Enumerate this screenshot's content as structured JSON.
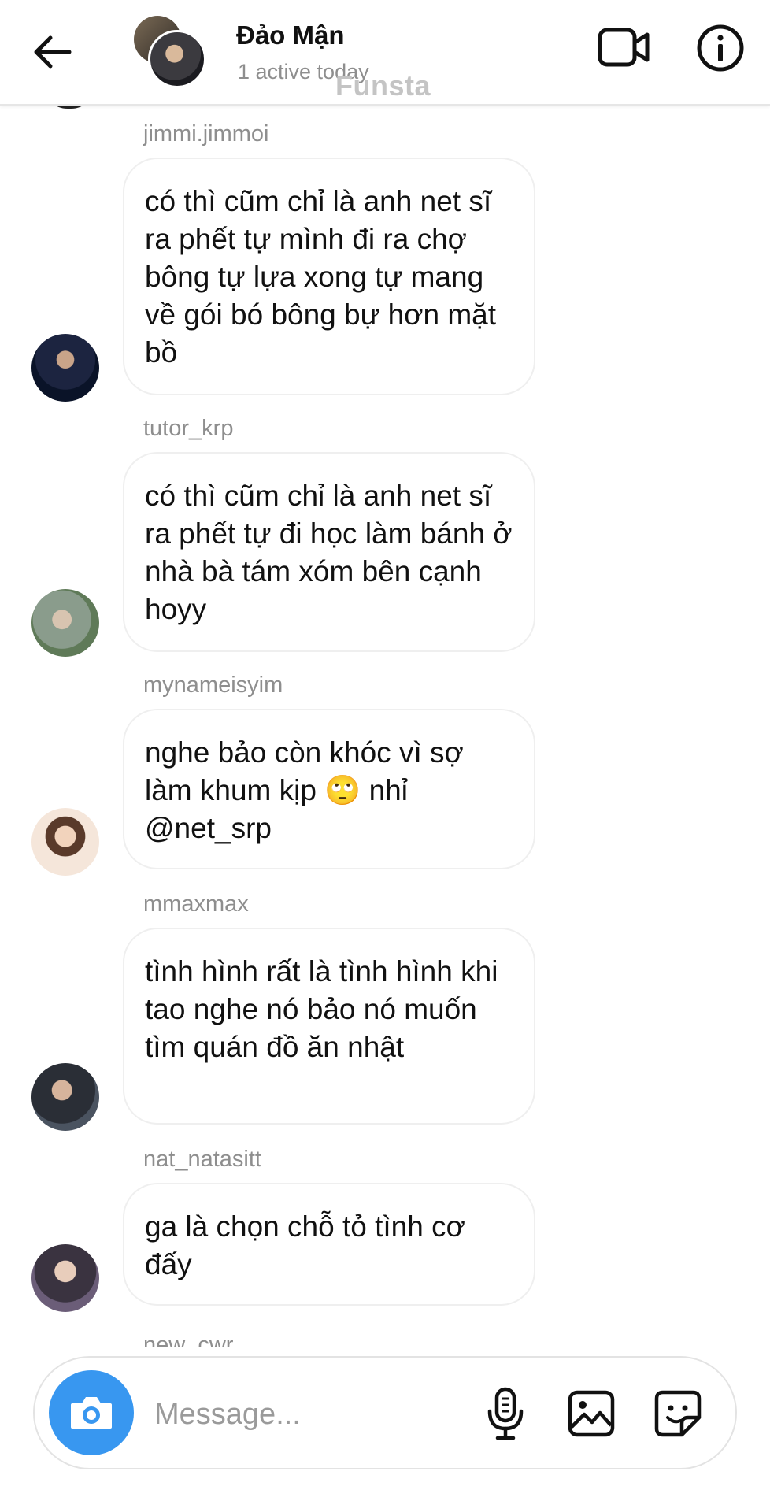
{
  "header": {
    "name": "Đảo Mận",
    "status": "1 active today",
    "watermark": "Funsta",
    "icons": {
      "back": "arrow-left-icon",
      "video": "video-call-icon",
      "info": "info-icon"
    }
  },
  "messages": [
    {
      "username": "jimmi.jimmoi",
      "text": "có thì cũm chỉ là anh net sĩ ra phết tự mình đi ra chợ bông tự lựa xong tự mang về gói bó bông bự hơn mặt bồ"
    },
    {
      "username": "tutor_krp",
      "text": "có thì cũm chỉ là anh net sĩ ra phết tự đi học làm bánh ở nhà bà tám xóm bên cạnh hoyy"
    },
    {
      "username": "mynameisyim",
      "text": "nghe bảo còn khóc vì sợ làm khum kịp 🙄 nhỉ @net_srp"
    },
    {
      "username": "mmaxmax",
      "text": "tình hình rất là tình hình khi tao nghe nó bảo nó muốn tìm quán đồ ăn nhật"
    },
    {
      "username": "nat_natasitt",
      "text": "ga là chọn chỗ tỏ tình cơ đấy"
    }
  ],
  "cut_username": "new_cwr",
  "composer": {
    "placeholder": "Message...",
    "value": "",
    "accent_color": "#3897f0",
    "icons": {
      "camera": "camera-icon",
      "mic": "microphone-icon",
      "gallery": "gallery-icon",
      "sticker": "sticker-icon"
    }
  }
}
